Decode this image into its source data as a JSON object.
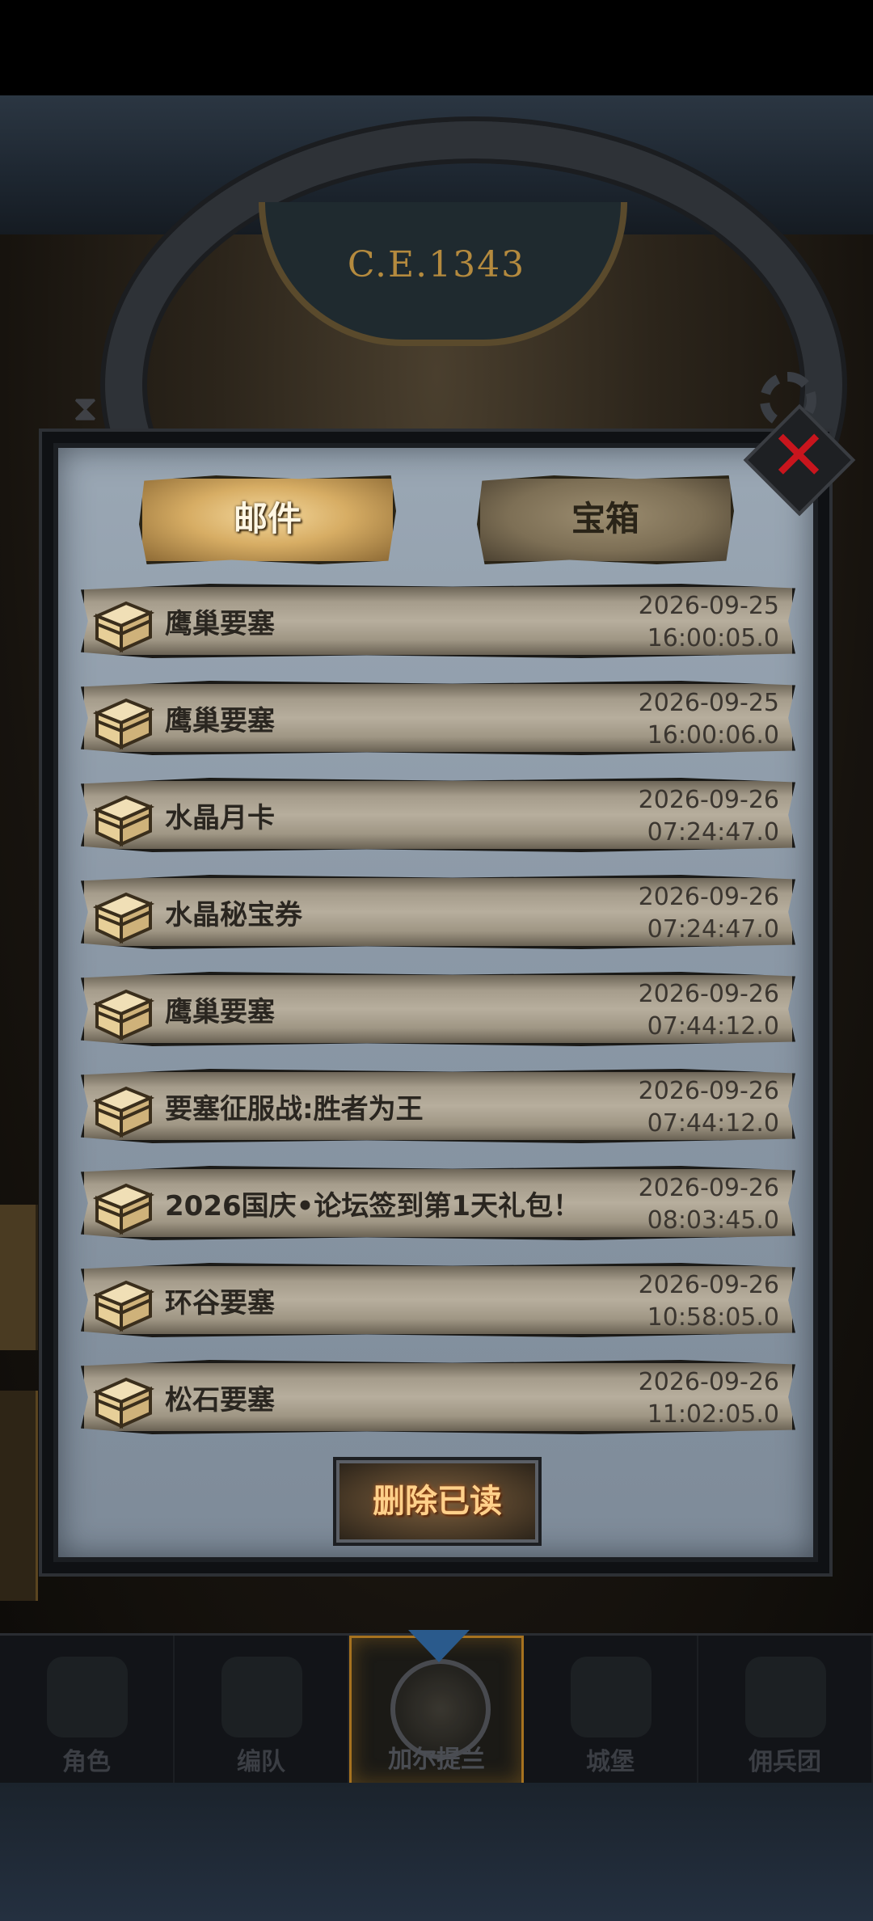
{
  "header": {
    "era": "C.E.1343"
  },
  "tabs": {
    "mail": "邮件",
    "chest": "宝箱"
  },
  "mails": [
    {
      "title": "鹰巢要塞",
      "date": "2026-09-25",
      "time": "16:00:05.0"
    },
    {
      "title": "鹰巢要塞",
      "date": "2026-09-25",
      "time": "16:00:06.0"
    },
    {
      "title": "水晶月卡",
      "date": "2026-09-26",
      "time": "07:24:47.0"
    },
    {
      "title": "水晶秘宝券",
      "date": "2026-09-26",
      "time": "07:24:47.0"
    },
    {
      "title": "鹰巢要塞",
      "date": "2026-09-26",
      "time": "07:44:12.0"
    },
    {
      "title": "要塞征服战:胜者为王",
      "date": "2026-09-26",
      "time": "07:44:12.0"
    },
    {
      "title": "2026国庆•论坛签到第1天礼包！",
      "date": "2026-09-26",
      "time": "08:03:45.0"
    },
    {
      "title": "环谷要塞",
      "date": "2026-09-26",
      "time": "10:58:05.0"
    },
    {
      "title": "松石要塞",
      "date": "2026-09-26",
      "time": "11:02:05.0"
    }
  ],
  "actions": {
    "delete_read": "删除已读"
  },
  "nav": {
    "items": [
      {
        "label": "角色"
      },
      {
        "label": "编队"
      },
      {
        "label": "加尔提兰",
        "active": true
      },
      {
        "label": "城堡"
      },
      {
        "label": "佣兵团"
      }
    ]
  },
  "colors": {
    "close_icon": "#c8151d",
    "active_tab": "#d7ad64",
    "delete_text": "#ffd08a"
  }
}
